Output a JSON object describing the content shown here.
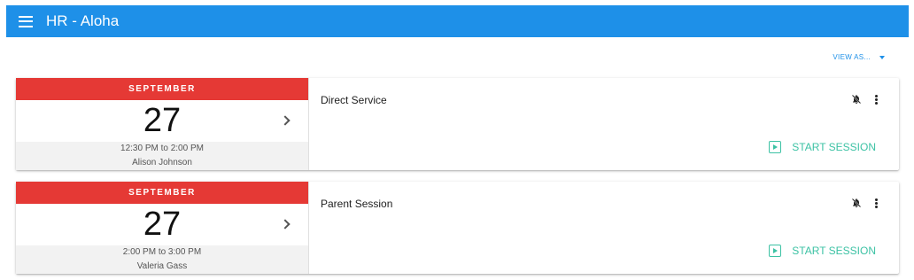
{
  "app": {
    "title": "HR - Aloha"
  },
  "toolbar": {
    "view_as_label": "VIEW AS..."
  },
  "appointments": [
    {
      "month": "SEPTEMBER",
      "day": "27",
      "time": "12:30 PM to 2:00 PM",
      "person": "Alison Johnson",
      "session": "Direct Service",
      "action": "START SESSION"
    },
    {
      "month": "SEPTEMBER",
      "day": "27",
      "time": "2:00 PM to 3:00 PM",
      "person": "Valeria Gass",
      "session": "Parent Session",
      "action": "START SESSION"
    }
  ],
  "colors": {
    "appbar": "#1e90e8",
    "month_band": "#e53935",
    "accent_green": "#3cc2a4"
  },
  "icons": [
    "menu-icon",
    "chevron-right-icon",
    "notifications-off-icon",
    "more-vert-icon",
    "play-icon",
    "caret-down-icon"
  ]
}
